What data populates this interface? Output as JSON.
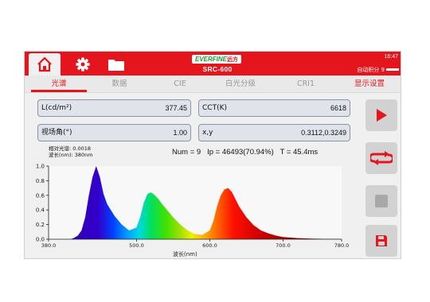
{
  "header": {
    "brand": "EVERFINE",
    "brand_cn": "远方",
    "model": "SRC-600",
    "time": "16:47",
    "auto_integration": "自动积分 9"
  },
  "tabs": [
    "光谱",
    "数据",
    "CIE",
    "白光分级",
    "CRI1",
    "显示设置"
  ],
  "fields": {
    "luminance": {
      "label": "L(cd/m²)",
      "value": "377.45"
    },
    "cct": {
      "label": "CCT(K)",
      "value": "6618"
    },
    "view_angle": {
      "label": "视场角(°)",
      "value": "1.00"
    },
    "xy": {
      "label": "x,y",
      "value": "0.3112,0.3249"
    }
  },
  "stats": {
    "num": "Num = 9",
    "ip": "Ip = 46493(70.94%)",
    "t": "T = 45.4ms"
  },
  "peak_info": {
    "rel": "相对光谱: 0.0018",
    "wl": "波长(nm): 380nm"
  },
  "chart_data": {
    "type": "area",
    "xlabel": "波长(nm)",
    "ylabel": "",
    "xlim": [
      380,
      780
    ],
    "ylim": [
      0,
      1.0
    ],
    "x_ticks": [
      "380.0",
      "500.0",
      "600.0",
      "700.0",
      "780.0"
    ],
    "x_tick_values": [
      380,
      500,
      600,
      700,
      780
    ],
    "y_ticks": [
      "1.0",
      "0.8",
      "0.6",
      "0.4",
      "0.2",
      "0.0"
    ],
    "y_tick_values": [
      1.0,
      0.8,
      0.6,
      0.4,
      0.2,
      0.0
    ],
    "series": [
      {
        "x": [
          380,
          400,
          410,
          415,
          420,
          425,
          430,
          435,
          440,
          445,
          450,
          455,
          460,
          465,
          470,
          480,
          490,
          500,
          505,
          510,
          515,
          520,
          525,
          530,
          535,
          540,
          550,
          560,
          570,
          580,
          590,
          600,
          605,
          610,
          615,
          620,
          625,
          630,
          635,
          640,
          650,
          660,
          670,
          680,
          690,
          700,
          720,
          740,
          760,
          780
        ],
        "values": [
          0,
          0,
          0,
          0.02,
          0.05,
          0.12,
          0.3,
          0.6,
          0.85,
          1.0,
          0.85,
          0.62,
          0.48,
          0.4,
          0.32,
          0.2,
          0.12,
          0.16,
          0.3,
          0.5,
          0.62,
          0.64,
          0.6,
          0.55,
          0.48,
          0.42,
          0.3,
          0.2,
          0.12,
          0.07,
          0.06,
          0.12,
          0.25,
          0.45,
          0.6,
          0.68,
          0.7,
          0.65,
          0.55,
          0.45,
          0.3,
          0.19,
          0.12,
          0.08,
          0.05,
          0.03,
          0.015,
          0.008,
          0.004,
          0.002
        ]
      }
    ]
  },
  "sidebar": [
    "play-icon",
    "loop-icon",
    "stop-icon",
    "save-icon"
  ]
}
